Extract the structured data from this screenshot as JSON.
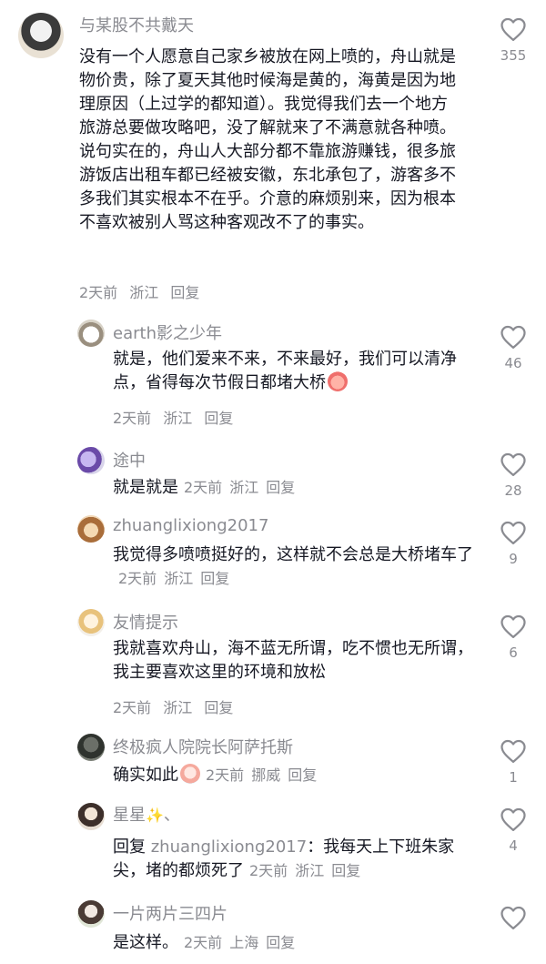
{
  "top_comment": {
    "username": "与某股不共戴天",
    "text": "没有一个人愿意自己家乡被放在网上喷的，舟山就是物价贵，除了夏天其他时候海是黄的，海黄是因为地理原因（上过学的都知道）。我觉得我们去一个地方旅游总要做攻略吧，没了解就来了不满意就各种喷。说句实在的，舟山人大部分都不靠旅游赚钱，很多旅游饭店出租车都已经被安徽，东北承包了，游客多不多我们其实根本不在乎。介意的麻烦别来，因为根本不喜欢被别人骂这种客观改不了的事实。",
    "time": "2天前",
    "location": "浙江",
    "reply_label": "回复",
    "likes": "355"
  },
  "replies": [
    {
      "username": "earth影之少年",
      "text": "就是，他们爱来不来，不来最好，我们可以清净点，省得每次节假日都堵大桥",
      "emoji": "peach-emoji",
      "time": "2天前",
      "location": "浙江",
      "reply_label": "回复",
      "likes": "46"
    },
    {
      "username": "途中",
      "text": "就是就是",
      "time": "2天前",
      "location": "浙江",
      "reply_label": "回复",
      "likes": "28"
    },
    {
      "username": "zhuanglixiong2017",
      "text": "我觉得多喷喷挺好的，这样就不会总是大桥堵车了",
      "time": "2天前",
      "location": "浙江",
      "reply_label": "回复",
      "likes": "9"
    },
    {
      "username": "友情提示",
      "text": "我就喜欢舟山，海不蓝无所谓，吃不惯也无所谓，我主要喜欢这里的环境和放松",
      "time": "2天前",
      "location": "浙江",
      "reply_label": "回复",
      "likes": "6"
    },
    {
      "username": "终极疯人院院长阿萨托斯",
      "text": "确实如此",
      "emoji": "crying-emoji",
      "time": "2天前",
      "location": "挪威",
      "reply_label": "回复",
      "likes": "1"
    },
    {
      "username": "星星",
      "username_suffix": "、",
      "prefix": "回复",
      "mention": "zhuanglixiong2017",
      "text": "：我每天上下班朱家尖，堵的都烦死了",
      "time": "2天前",
      "location": "浙江",
      "reply_label": "回复",
      "likes": "4"
    },
    {
      "username": "一片两片三四片",
      "text": "是这样。",
      "time": "2天前",
      "location": "上海",
      "reply_label": "回复",
      "likes": ""
    }
  ],
  "icons": {
    "heart": "heart-outline-icon",
    "sparkle": "sparkles-icon"
  },
  "colors": {
    "text": "#161823",
    "meta": "#8a8b91",
    "heart_stroke": "#8a8b91"
  }
}
